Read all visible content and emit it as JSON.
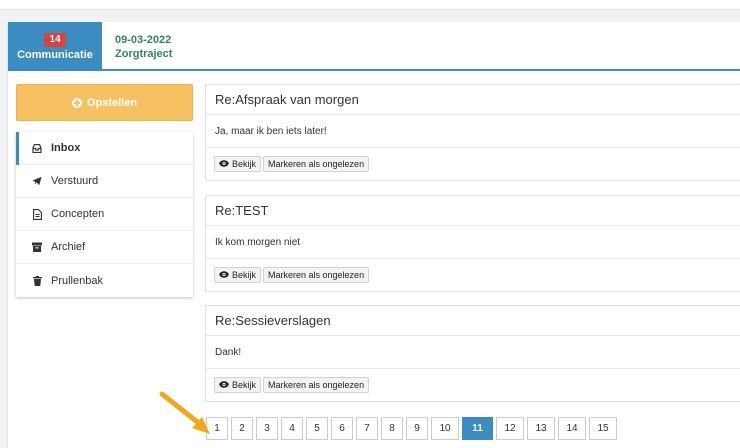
{
  "tab": {
    "badge": "14",
    "label": "Communicatie"
  },
  "header_info": {
    "date": "09-03-2022",
    "subtitle": "Zorgtraject"
  },
  "compose": {
    "label": "Opstellen"
  },
  "folders": [
    {
      "label": "Inbox",
      "icon": "inbox-icon"
    },
    {
      "label": "Verstuurd",
      "icon": "paper-plane-icon"
    },
    {
      "label": "Concepten",
      "icon": "file-icon"
    },
    {
      "label": "Archief",
      "icon": "archive-icon"
    },
    {
      "label": "Prullenbak",
      "icon": "trash-icon"
    }
  ],
  "messages": [
    {
      "subject": "Re:Afspraak van morgen",
      "body": "Ja, maar ik ben iets later!",
      "view_label": "Bekijk",
      "mark_label": "Markeren als ongelezen"
    },
    {
      "subject": "Re:TEST",
      "body": "Ik kom morgen niet",
      "view_label": "Bekijk",
      "mark_label": "Markeren als ongelezen"
    },
    {
      "subject": "Re:Sessieverslagen",
      "body": "Dank!",
      "view_label": "Bekijk",
      "mark_label": "Markeren als ongelezen"
    }
  ],
  "pagination": {
    "pages": [
      "1",
      "2",
      "3",
      "4",
      "5",
      "6",
      "7",
      "8",
      "9",
      "10",
      "11",
      "12",
      "13",
      "14",
      "15"
    ],
    "current": "11"
  },
  "colors": {
    "primary": "#3a8cc1",
    "compose": "#f7c163",
    "badge": "#d9443a",
    "info_green": "#2e8b57",
    "arrow": "#f0a818"
  }
}
